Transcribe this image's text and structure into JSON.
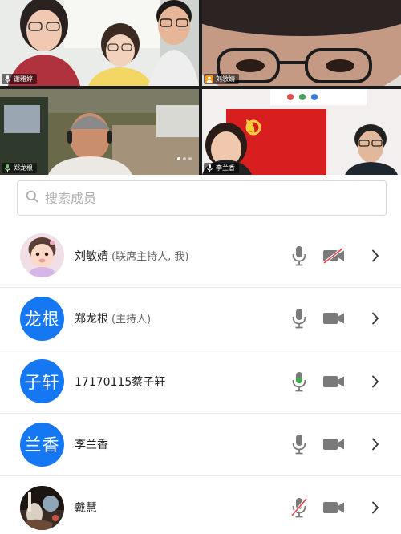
{
  "video_tiles": [
    {
      "name": "谢雅婷",
      "icon": "mic-icon"
    },
    {
      "name": "刘敏婧",
      "icon": "person-icon"
    },
    {
      "name": "郑龙根",
      "icon": "mic-icon"
    },
    {
      "name": "李兰香",
      "icon": "mic-icon"
    }
  ],
  "search": {
    "placeholder": "搜索成员"
  },
  "members": [
    {
      "name": "刘敏婧",
      "role": "(联席主持人, 我)",
      "avatar_text": "",
      "avatar_kind": "photo-child",
      "mic": "off",
      "camera": "off"
    },
    {
      "name": "郑龙根",
      "role": "(主持人)",
      "avatar_text": "龙根",
      "avatar_kind": "text",
      "mic": "idle",
      "camera": "on"
    },
    {
      "name": "17170115蔡子轩",
      "role": "",
      "avatar_text": "子轩",
      "avatar_kind": "text",
      "mic": "speaking",
      "camera": "on"
    },
    {
      "name": "李兰香",
      "role": "",
      "avatar_text": "兰香",
      "avatar_kind": "text",
      "mic": "idle",
      "camera": "on"
    },
    {
      "name": "戴慧",
      "role": "",
      "avatar_text": "",
      "avatar_kind": "photo-scene",
      "mic": "muted",
      "camera": "on"
    }
  ],
  "colors": {
    "accent_blue": "#1677f2",
    "speaking_green": "#3cb14a",
    "muted_red": "#e64545",
    "icon_gray": "#7a7a7a"
  }
}
